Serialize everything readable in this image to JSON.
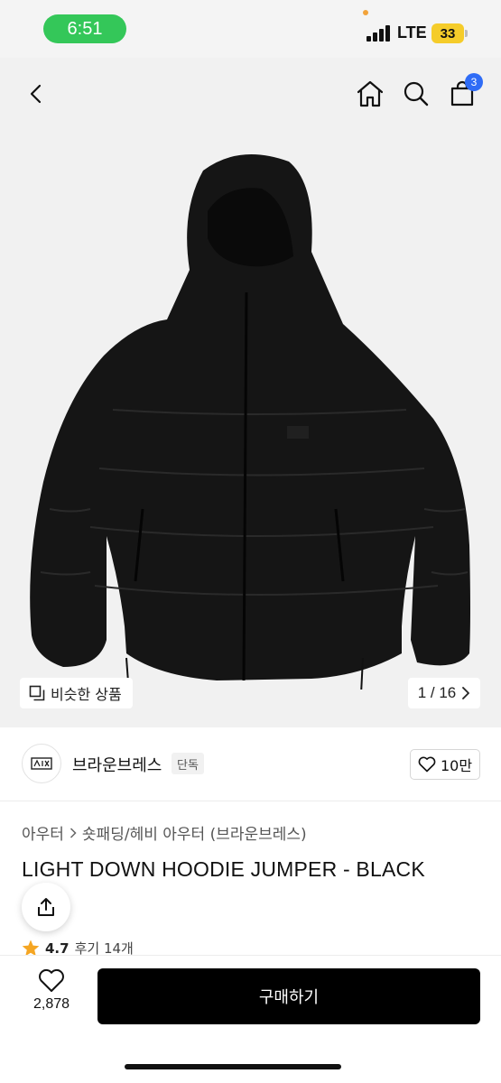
{
  "status_bar": {
    "time": "6:51",
    "network": "LTE",
    "battery": "33"
  },
  "nav": {
    "cart_count": "3",
    "icons": [
      "back-icon",
      "home-icon",
      "search-icon",
      "cart-icon"
    ]
  },
  "gallery": {
    "similar_label": "비슷한 상품",
    "counter": "1 / 16"
  },
  "brand": {
    "name": "브라운브레스",
    "badge": "단독",
    "likes": "10만"
  },
  "product": {
    "breadcrumb": [
      "아우터",
      "숏패딩/헤비 아우터 (브라운브레스)"
    ],
    "title": "LIGHT DOWN HOODIE JUMPER - BLACK",
    "rating": "4.7",
    "reviews": "후기 14개"
  },
  "bottom_bar": {
    "wish_count": "2,878",
    "buy_label": "구매하기"
  },
  "colors": {
    "accent_green": "#34c759",
    "badge_blue": "#2f6cf6",
    "star": "#f5a623",
    "buy_button": "#000000"
  }
}
